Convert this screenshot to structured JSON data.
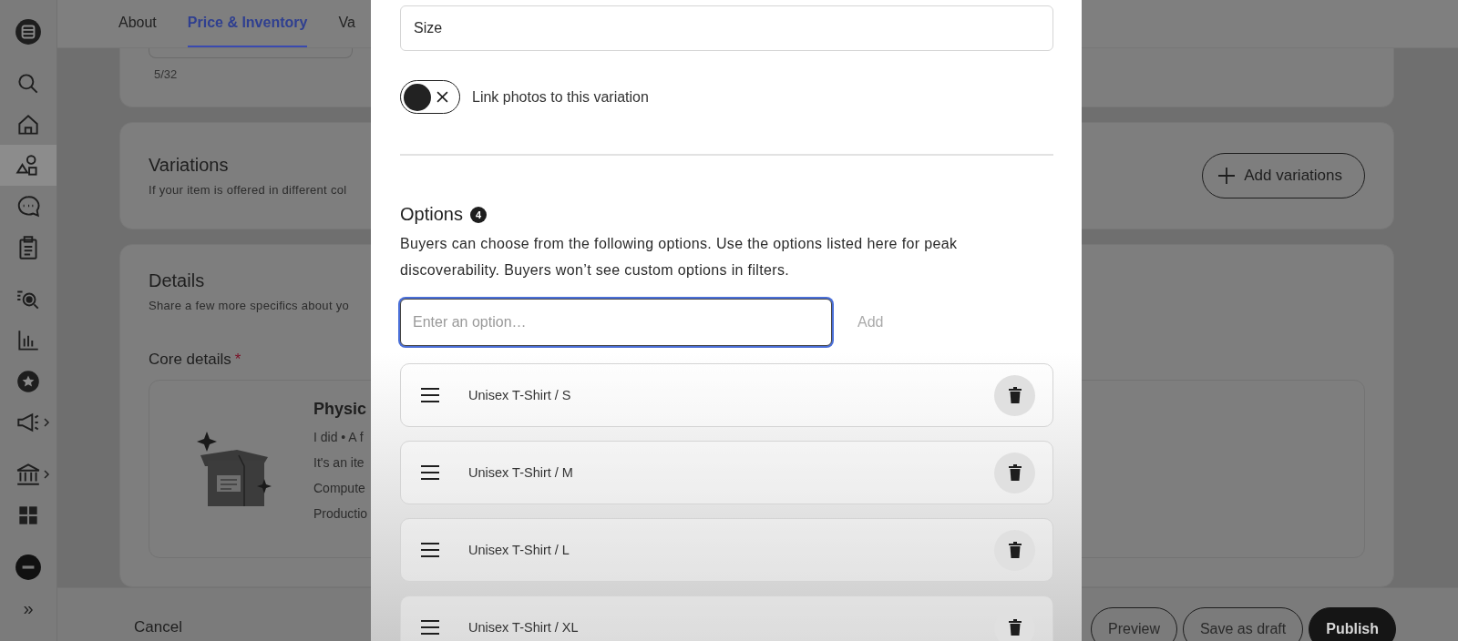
{
  "sidebar": {
    "groups": [
      [
        {
          "selected": false,
          "has_submenu": false
        }
      ],
      [
        {
          "selected": false,
          "has_submenu": false
        },
        {
          "selected": false,
          "has_submenu": false
        },
        {
          "selected": true,
          "has_submenu": false
        },
        {
          "selected": false,
          "has_submenu": false
        },
        {
          "selected": false,
          "has_submenu": false
        }
      ],
      [
        {
          "selected": false,
          "has_submenu": false
        },
        {
          "selected": false,
          "has_submenu": false
        },
        {
          "selected": false,
          "has_submenu": false
        },
        {
          "selected": false,
          "has_submenu": true
        }
      ],
      [
        {
          "selected": false,
          "has_submenu": true
        },
        {
          "selected": false,
          "has_submenu": false
        }
      ],
      [
        {
          "selected": false,
          "has_submenu": false
        }
      ]
    ],
    "expand": "»"
  },
  "tabs": [
    {
      "label": "About",
      "selected": false
    },
    {
      "label": "Price & Inventory",
      "selected": true
    },
    {
      "label": "Va",
      "selected": false
    }
  ],
  "title_card": {
    "counter": "5/32"
  },
  "variations": {
    "title": "Variations",
    "description": "If your item is offered in different col",
    "add_button": "Add variations"
  },
  "details": {
    "title": "Details",
    "description": "Share a few more specifics about yo",
    "core_details": {
      "label": "Core details",
      "required_mark": "*"
    },
    "item_type": {
      "title": "Physic",
      "lines": [
        "I did • A f",
        "It's an ite",
        "Compute",
        "Productio"
      ]
    }
  },
  "footer": {
    "cancel": "Cancel",
    "buttons": [
      {
        "label": "Preview",
        "kind": "outline"
      },
      {
        "label": "Save as draft",
        "kind": "outline"
      },
      {
        "label": "Publish",
        "kind": "primary"
      }
    ]
  },
  "dialog": {
    "variation_name": {
      "value": "Size"
    },
    "link_photos": {
      "label": "Link photos to this variation",
      "on": false
    },
    "options": {
      "title": "Options",
      "count": "4",
      "description": "Buyers can choose from the following options. Use the options listed here for peak discoverability. Buyers won’t see custom options in filters.",
      "input": {
        "placeholder": "Enter an option…",
        "focused": true
      },
      "add_button": {
        "label": "Add",
        "disabled": true
      },
      "items": [
        {
          "label": "Unisex T-Shirt / S"
        },
        {
          "label": "Unisex T-Shirt / M"
        },
        {
          "label": "Unisex T-Shirt / L"
        },
        {
          "label": "Unisex T-Shirt / XL"
        }
      ]
    }
  }
}
